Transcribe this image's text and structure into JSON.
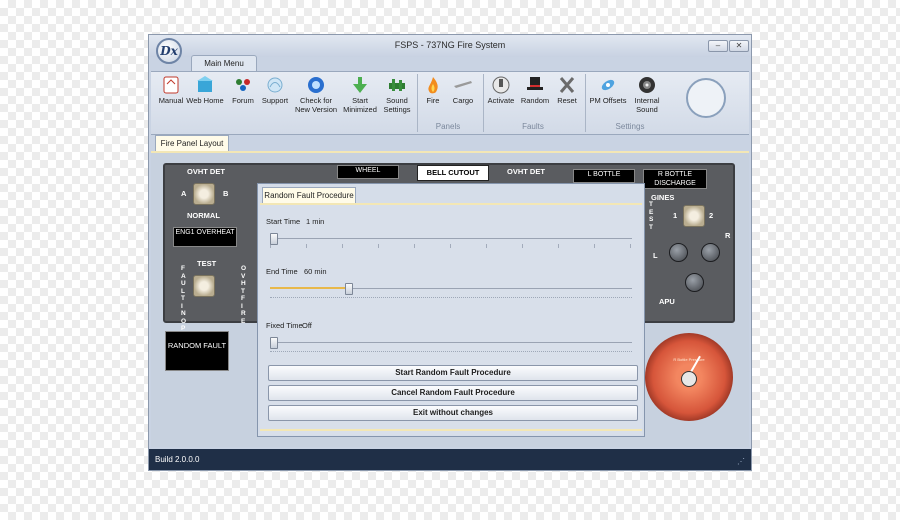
{
  "window": {
    "title": "FSPS - 737NG Fire System",
    "logo_text": "Dx"
  },
  "ribbon": {
    "tab": "Main Menu",
    "buttons": [
      {
        "label": "Manual",
        "icon": "manual-icon"
      },
      {
        "label": "Web Home",
        "icon": "web-home-icon"
      },
      {
        "label": "Forum",
        "icon": "forum-icon"
      },
      {
        "label": "Support",
        "icon": "support-icon"
      },
      {
        "label": "Check for New Version",
        "icon": "check-version-icon"
      },
      {
        "label": "Start Minimized",
        "icon": "start-minimized-icon"
      },
      {
        "label": "Sound Settings",
        "icon": "sound-settings-icon"
      },
      {
        "label": "Fire",
        "icon": "fire-icon"
      },
      {
        "label": "Cargo",
        "icon": "cargo-icon"
      },
      {
        "label": "Activate",
        "icon": "activate-icon"
      },
      {
        "label": "Random",
        "icon": "random-icon"
      },
      {
        "label": "Reset",
        "icon": "reset-icon"
      },
      {
        "label": "PM Offsets",
        "icon": "pm-offsets-icon"
      },
      {
        "label": "Internal Sound",
        "icon": "internal-sound-icon"
      }
    ],
    "groups": [
      "Panels",
      "Faults",
      "Settings"
    ]
  },
  "doc_tab": "Fire Panel Layout",
  "panel": {
    "ovht_det_left": "OVHT DET",
    "sel_a": "A",
    "sel_b": "B",
    "normal": "NORMAL",
    "eng1_overheat": "ENG1 OVERHEAT",
    "test": "TEST",
    "fault_inop": "F A U L T I N O P",
    "ovht_fire": "O V H T F I R E",
    "wheel": "WHEEL",
    "bell_cutout": "BELL CUTOUT",
    "ovht_det_right": "OVHT DET",
    "l_bottle": "L BOTTLE",
    "r_bottle_discharge": "R  BOTTLE DISCHARGE",
    "engines": "GINES",
    "test_vertical": "T E S T",
    "knob_1": "1",
    "knob_2": "2",
    "left_l": "L",
    "right_r": "R",
    "apu": "APU",
    "random_fault": "RANDOM FAULT"
  },
  "gauge": {
    "label": "R Bottle Pressure"
  },
  "dialog": {
    "tab": "Random Fault Procedure",
    "start_label": "Start Time",
    "start_value": "1 min",
    "start_level": 0.0,
    "end_label": "End Time",
    "end_value": "60 min",
    "end_level": 0.21,
    "fixed_label": "Fixed Time",
    "fixed_value": "Off",
    "fixed_level": 0.0,
    "start_button": "Start Random Fault Procedure",
    "cancel_button": "Cancel Random Fault Procedure",
    "exit_button": "Exit without changes"
  },
  "status": {
    "build": "Build 2.0.0.0"
  },
  "colors": {
    "status_bar": "#1f2f47",
    "accent": "#e8b84a",
    "panel": "#5a5c60"
  }
}
